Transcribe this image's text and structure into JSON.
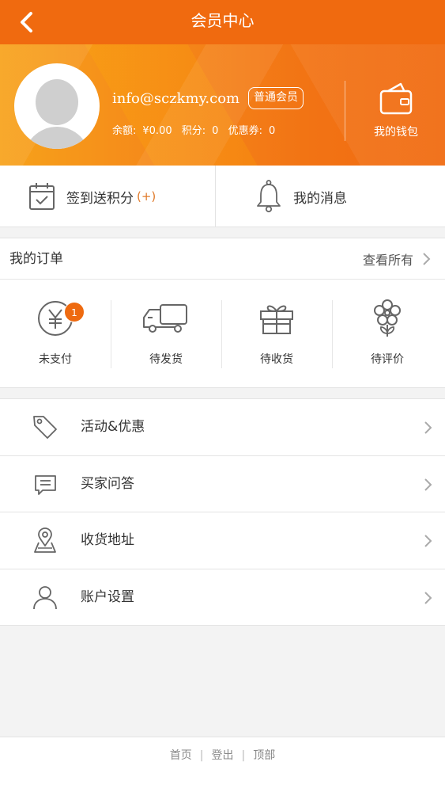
{
  "nav": {
    "title": "会员中心",
    "back_icon": "chevron-left-icon"
  },
  "profile": {
    "email": "info@sczkmy.com",
    "level": "普通会员",
    "balance_label": "余额:",
    "balance_value": "¥0.00",
    "points_label": "积分:",
    "points_value": "0",
    "coupons_label": "优惠券:",
    "coupons_value": "0",
    "wallet_label": "我的钱包"
  },
  "quick": {
    "checkin_label": "签到送积分",
    "checkin_plus": "(+)",
    "messages_label": "我的消息"
  },
  "orders": {
    "title": "我的订单",
    "view_all": "查看所有",
    "items": [
      {
        "label": "未支付",
        "icon": "yuan-icon",
        "badge": "1"
      },
      {
        "label": "待发货",
        "icon": "truck-icon"
      },
      {
        "label": "待收货",
        "icon": "gift-box-icon"
      },
      {
        "label": "待评价",
        "icon": "flower-icon"
      }
    ]
  },
  "menu": [
    {
      "label": "活动&优惠",
      "icon": "tag-icon"
    },
    {
      "label": "买家问答",
      "icon": "chat-icon"
    },
    {
      "label": "收货地址",
      "icon": "location-icon"
    },
    {
      "label": "账户设置",
      "icon": "user-icon"
    }
  ],
  "footer": {
    "home": "首页",
    "logout": "登出",
    "top": "顶部",
    "separator": "|"
  },
  "colors": {
    "primary": "#f06a0f",
    "badge": "#ee6a10",
    "accent": "#e07a2a"
  }
}
